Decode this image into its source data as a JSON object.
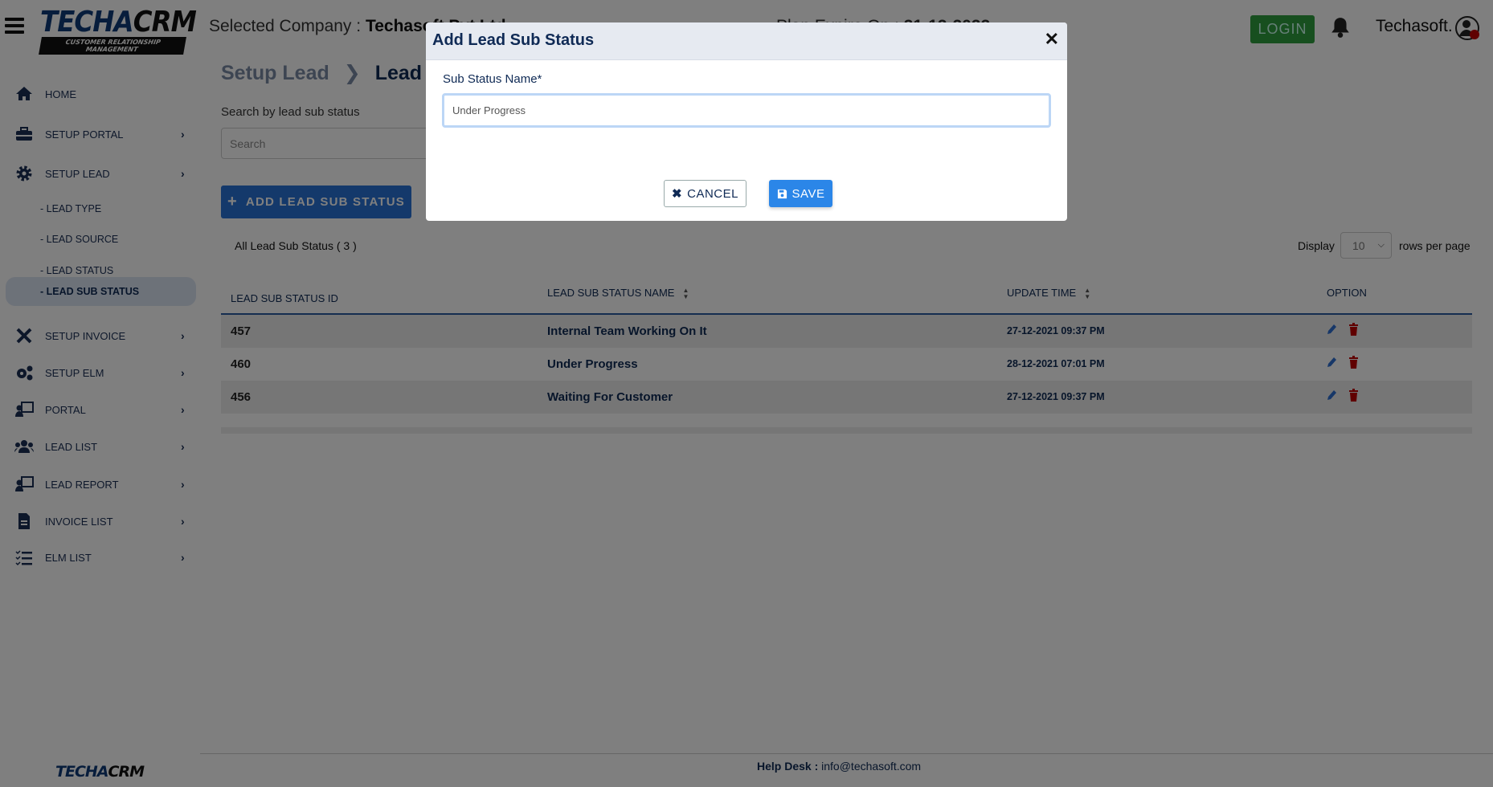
{
  "header": {
    "logo_text": "TECHACRM",
    "logo_tagline": "CUSTOMER RELATIONSHIP MANAGEMENT",
    "company_label": "Selected Company :",
    "company_name": "Techasoft Pvt Ltd",
    "plan_label": "Plan Expire On :",
    "plan_date": "31-12-2022",
    "login_label": "LOGIN",
    "user_name": "Techasoft."
  },
  "sidebar": {
    "items": [
      {
        "label": "HOME",
        "icon": "home-icon"
      },
      {
        "label": "SETUP PORTAL",
        "icon": "toolbox-icon"
      },
      {
        "label": "SETUP LEAD",
        "icon": "gear-icon"
      },
      {
        "label": "- LEAD TYPE"
      },
      {
        "label": "- LEAD SOURCE"
      },
      {
        "label": "- LEAD STATUS"
      },
      {
        "label": "- LEAD SUB STATUS",
        "active": true
      },
      {
        "label": "SETUP INVOICE",
        "icon": "tools-icon"
      },
      {
        "label": "SETUP ELM",
        "icon": "gears-icon"
      },
      {
        "label": "PORTAL",
        "icon": "presenter-icon"
      },
      {
        "label": "LEAD LIST",
        "icon": "users-icon"
      },
      {
        "label": "LEAD REPORT",
        "icon": "presenter-icon"
      },
      {
        "label": "INVOICE LIST",
        "icon": "document-icon"
      },
      {
        "label": "ELM LIST",
        "icon": "checklist-icon"
      }
    ]
  },
  "main": {
    "breadcrumb": [
      "Setup Lead",
      "Lead Sub Status"
    ],
    "search_label": "Search by lead sub status",
    "search_placeholder": "Search",
    "add_button": "ADD LEAD SUB STATUS",
    "count_label": "All Lead Sub Status ( 3 )",
    "display_label": "Display",
    "rows_per_page_value": "10",
    "rows_per_page_label": "rows per page",
    "table": {
      "columns": [
        "LEAD SUB STATUS ID",
        "LEAD SUB STATUS NAME",
        "UPDATE TIME",
        "OPTION"
      ],
      "rows": [
        {
          "id": "457",
          "name": "Internal Team Working On It",
          "time": "27-12-2021 09:37 PM"
        },
        {
          "id": "460",
          "name": "Under Progress",
          "time": "28-12-2021 07:01 PM"
        },
        {
          "id": "456",
          "name": "Waiting For Customer",
          "time": "27-12-2021 09:37 PM"
        }
      ]
    }
  },
  "footer": {
    "help_label": "Help Desk :",
    "help_email": "info@techasoft.com",
    "logo_text": "TECHACRM"
  },
  "modal": {
    "title": "Add Lead Sub Status",
    "field_label": "Sub Status Name*",
    "field_value": "Under Progress",
    "cancel_label": "CANCEL",
    "save_label": "SAVE"
  },
  "colors": {
    "accent": "#2872d6",
    "login": "#2e9e3e",
    "delete": "#c00000",
    "edit": "#2f6fd0"
  }
}
